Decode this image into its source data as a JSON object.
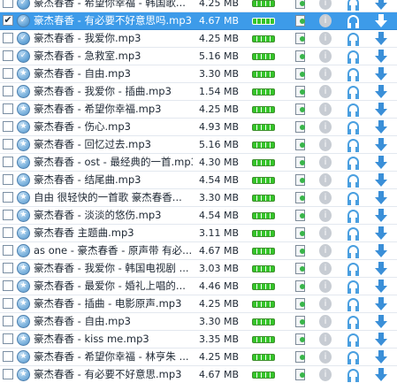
{
  "colors": {
    "selected_row": "#3d9be9",
    "progress": "#35c42a",
    "action_blue": "#3a8fd8"
  },
  "icons": {
    "status_done": "check-circle-icon",
    "status_queued": "star-circle-icon",
    "file": "file-icon",
    "info": "info-icon",
    "headphones": "headphones-icon",
    "download": "download-arrow-icon"
  },
  "rows": [
    {
      "name": "豪杰春香 - 希望你幸福 - 韩国歌...",
      "size": "4.25 MB",
      "checked": false,
      "status": "done",
      "selected": false
    },
    {
      "name": "豪杰春香 - 有必要不好意思吗.mp3",
      "size": "4.67 MB",
      "checked": true,
      "status": "done",
      "selected": true
    },
    {
      "name": "豪杰春香 - 我爱你.mp3",
      "size": "4.25 MB",
      "checked": false,
      "status": "done",
      "selected": false
    },
    {
      "name": "豪杰春香 - 急救室.mp3",
      "size": "5.16 MB",
      "checked": false,
      "status": "done",
      "selected": false
    },
    {
      "name": "豪杰春香 - 自由.mp3",
      "size": "3.30 MB",
      "checked": false,
      "status": "queued",
      "selected": false
    },
    {
      "name": "豪杰春香 - 我爱你 - 插曲.mp3",
      "size": "1.54 MB",
      "checked": false,
      "status": "queued",
      "selected": false
    },
    {
      "name": "豪杰春香 - 希望你幸福.mp3",
      "size": "4.25 MB",
      "checked": false,
      "status": "queued",
      "selected": false
    },
    {
      "name": "豪杰春香 - 伤心.mp3",
      "size": "4.93 MB",
      "checked": false,
      "status": "queued",
      "selected": false
    },
    {
      "name": "豪杰春香 - 回忆过去.mp3",
      "size": "5.16 MB",
      "checked": false,
      "status": "queued",
      "selected": false
    },
    {
      "name": "豪杰春香 - ost - 最经典的一首.mp3",
      "size": "4.30 MB",
      "checked": false,
      "status": "queued",
      "selected": false
    },
    {
      "name": "豪杰春香 - 结尾曲.mp3",
      "size": "4.54 MB",
      "checked": false,
      "status": "queued",
      "selected": false
    },
    {
      "name": "自由 很轻快的一首歌 豪杰春香...",
      "size": "3.30 MB",
      "checked": false,
      "status": "queued",
      "selected": false
    },
    {
      "name": "豪杰春香 - 淡淡的悠伤.mp3",
      "size": "4.54 MB",
      "checked": false,
      "status": "queued",
      "selected": false
    },
    {
      "name": "豪杰春香 主题曲.mp3",
      "size": "3.11 MB",
      "checked": false,
      "status": "queued",
      "selected": false
    },
    {
      "name": "as one - 豪杰春香 - 原声带 有必...",
      "size": "4.67 MB",
      "checked": false,
      "status": "queued",
      "selected": false
    },
    {
      "name": "豪杰春香 - 我爱你 - 韩国电视剧 ...",
      "size": "3.03 MB",
      "checked": false,
      "status": "queued",
      "selected": false
    },
    {
      "name": "豪杰春香 - 最爱你 - 婚礼上唱的...",
      "size": "4.46 MB",
      "checked": false,
      "status": "queued",
      "selected": false
    },
    {
      "name": "豪杰春香 - 插曲 - 电影原声.mp3",
      "size": "4.25 MB",
      "checked": false,
      "status": "queued",
      "selected": false
    },
    {
      "name": "豪杰春香 - 自由.mp3",
      "size": "3.30 MB",
      "checked": false,
      "status": "queued",
      "selected": false
    },
    {
      "name": "豪杰春香 - kiss me.mp3",
      "size": "3.35 MB",
      "checked": false,
      "status": "queued",
      "selected": false
    },
    {
      "name": "豪杰春香 - 希望你幸福 - 林亨朱 ...",
      "size": "4.25 MB",
      "checked": false,
      "status": "queued",
      "selected": false
    },
    {
      "name": "豪杰春香 - 有必要不好意思.mp3",
      "size": "4.67 MB",
      "checked": false,
      "status": "queued",
      "selected": false
    }
  ]
}
